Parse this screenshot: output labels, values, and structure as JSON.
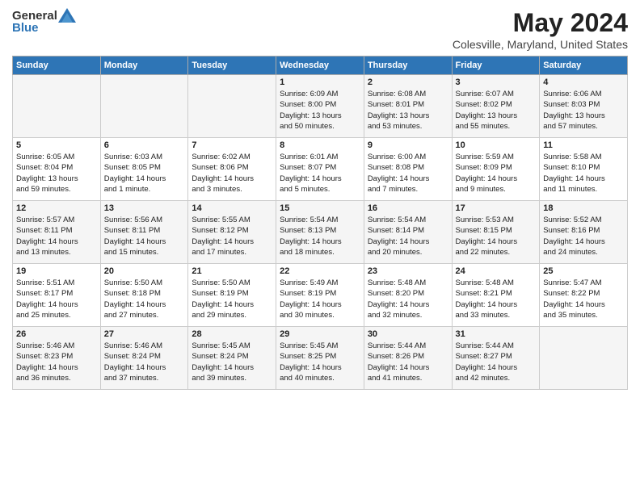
{
  "header": {
    "logo_general": "General",
    "logo_blue": "Blue",
    "title": "May 2024",
    "subtitle": "Colesville, Maryland, United States"
  },
  "weekdays": [
    "Sunday",
    "Monday",
    "Tuesday",
    "Wednesday",
    "Thursday",
    "Friday",
    "Saturday"
  ],
  "weeks": [
    [
      {
        "day": "",
        "info": ""
      },
      {
        "day": "",
        "info": ""
      },
      {
        "day": "",
        "info": ""
      },
      {
        "day": "1",
        "info": "Sunrise: 6:09 AM\nSunset: 8:00 PM\nDaylight: 13 hours\nand 50 minutes."
      },
      {
        "day": "2",
        "info": "Sunrise: 6:08 AM\nSunset: 8:01 PM\nDaylight: 13 hours\nand 53 minutes."
      },
      {
        "day": "3",
        "info": "Sunrise: 6:07 AM\nSunset: 8:02 PM\nDaylight: 13 hours\nand 55 minutes."
      },
      {
        "day": "4",
        "info": "Sunrise: 6:06 AM\nSunset: 8:03 PM\nDaylight: 13 hours\nand 57 minutes."
      }
    ],
    [
      {
        "day": "5",
        "info": "Sunrise: 6:05 AM\nSunset: 8:04 PM\nDaylight: 13 hours\nand 59 minutes."
      },
      {
        "day": "6",
        "info": "Sunrise: 6:03 AM\nSunset: 8:05 PM\nDaylight: 14 hours\nand 1 minute."
      },
      {
        "day": "7",
        "info": "Sunrise: 6:02 AM\nSunset: 8:06 PM\nDaylight: 14 hours\nand 3 minutes."
      },
      {
        "day": "8",
        "info": "Sunrise: 6:01 AM\nSunset: 8:07 PM\nDaylight: 14 hours\nand 5 minutes."
      },
      {
        "day": "9",
        "info": "Sunrise: 6:00 AM\nSunset: 8:08 PM\nDaylight: 14 hours\nand 7 minutes."
      },
      {
        "day": "10",
        "info": "Sunrise: 5:59 AM\nSunset: 8:09 PM\nDaylight: 14 hours\nand 9 minutes."
      },
      {
        "day": "11",
        "info": "Sunrise: 5:58 AM\nSunset: 8:10 PM\nDaylight: 14 hours\nand 11 minutes."
      }
    ],
    [
      {
        "day": "12",
        "info": "Sunrise: 5:57 AM\nSunset: 8:11 PM\nDaylight: 14 hours\nand 13 minutes."
      },
      {
        "day": "13",
        "info": "Sunrise: 5:56 AM\nSunset: 8:11 PM\nDaylight: 14 hours\nand 15 minutes."
      },
      {
        "day": "14",
        "info": "Sunrise: 5:55 AM\nSunset: 8:12 PM\nDaylight: 14 hours\nand 17 minutes."
      },
      {
        "day": "15",
        "info": "Sunrise: 5:54 AM\nSunset: 8:13 PM\nDaylight: 14 hours\nand 18 minutes."
      },
      {
        "day": "16",
        "info": "Sunrise: 5:54 AM\nSunset: 8:14 PM\nDaylight: 14 hours\nand 20 minutes."
      },
      {
        "day": "17",
        "info": "Sunrise: 5:53 AM\nSunset: 8:15 PM\nDaylight: 14 hours\nand 22 minutes."
      },
      {
        "day": "18",
        "info": "Sunrise: 5:52 AM\nSunset: 8:16 PM\nDaylight: 14 hours\nand 24 minutes."
      }
    ],
    [
      {
        "day": "19",
        "info": "Sunrise: 5:51 AM\nSunset: 8:17 PM\nDaylight: 14 hours\nand 25 minutes."
      },
      {
        "day": "20",
        "info": "Sunrise: 5:50 AM\nSunset: 8:18 PM\nDaylight: 14 hours\nand 27 minutes."
      },
      {
        "day": "21",
        "info": "Sunrise: 5:50 AM\nSunset: 8:19 PM\nDaylight: 14 hours\nand 29 minutes."
      },
      {
        "day": "22",
        "info": "Sunrise: 5:49 AM\nSunset: 8:19 PM\nDaylight: 14 hours\nand 30 minutes."
      },
      {
        "day": "23",
        "info": "Sunrise: 5:48 AM\nSunset: 8:20 PM\nDaylight: 14 hours\nand 32 minutes."
      },
      {
        "day": "24",
        "info": "Sunrise: 5:48 AM\nSunset: 8:21 PM\nDaylight: 14 hours\nand 33 minutes."
      },
      {
        "day": "25",
        "info": "Sunrise: 5:47 AM\nSunset: 8:22 PM\nDaylight: 14 hours\nand 35 minutes."
      }
    ],
    [
      {
        "day": "26",
        "info": "Sunrise: 5:46 AM\nSunset: 8:23 PM\nDaylight: 14 hours\nand 36 minutes."
      },
      {
        "day": "27",
        "info": "Sunrise: 5:46 AM\nSunset: 8:24 PM\nDaylight: 14 hours\nand 37 minutes."
      },
      {
        "day": "28",
        "info": "Sunrise: 5:45 AM\nSunset: 8:24 PM\nDaylight: 14 hours\nand 39 minutes."
      },
      {
        "day": "29",
        "info": "Sunrise: 5:45 AM\nSunset: 8:25 PM\nDaylight: 14 hours\nand 40 minutes."
      },
      {
        "day": "30",
        "info": "Sunrise: 5:44 AM\nSunset: 8:26 PM\nDaylight: 14 hours\nand 41 minutes."
      },
      {
        "day": "31",
        "info": "Sunrise: 5:44 AM\nSunset: 8:27 PM\nDaylight: 14 hours\nand 42 minutes."
      },
      {
        "day": "",
        "info": ""
      }
    ]
  ]
}
